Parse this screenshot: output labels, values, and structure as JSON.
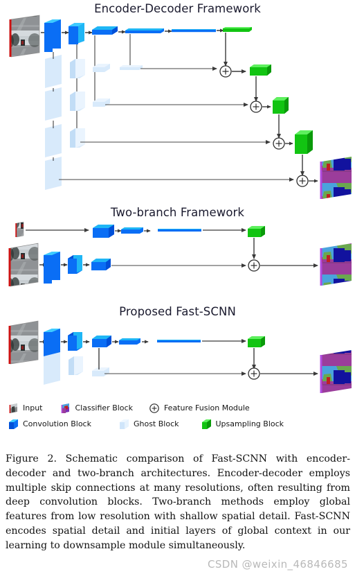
{
  "figure": {
    "panels": [
      {
        "id": "encoder-decoder",
        "title": "Encoder-Decoder Framework"
      },
      {
        "id": "two-branch",
        "title": "Two-branch Framework"
      },
      {
        "id": "fast-scnn",
        "title": "Proposed Fast-SCNN"
      }
    ]
  },
  "legend": {
    "items": [
      {
        "key": "input",
        "label": "Input",
        "glyph": "input-thumbnail-icon",
        "color": "#6f6f6f"
      },
      {
        "key": "classifier_block",
        "label": "Classifier Block",
        "glyph": "classifier-block-icon",
        "color": "#7a2fb5"
      },
      {
        "key": "feature_fusion_module",
        "label": "Feature Fusion Module",
        "glyph": "plus-circle-icon",
        "color": "#2b2b2b"
      },
      {
        "key": "convolution_block",
        "label": "Convolution Block",
        "glyph": "convolution-block-icon",
        "color": "#0a6ef5"
      },
      {
        "key": "ghost_block",
        "label": "Ghost Block",
        "glyph": "ghost-block-icon",
        "color": "#d6e8fb"
      },
      {
        "key": "upsampling_block",
        "label": "Upsampling Block",
        "glyph": "upsampling-block-icon",
        "color": "#12c412"
      }
    ]
  },
  "caption": {
    "text": "Figure 2. Schematic comparison of Fast-SCNN with encoder-decoder and two-branch architectures. Encoder-decoder employs multiple skip connections at many resolutions, often resulting from deep convolution blocks.  Two-branch methods employ global features from low resolution with shallow spatial detail. Fast-SCNN encodes spatial detail and initial layers of global context in our learning to downsample module simultaneously."
  },
  "watermark": {
    "text": "CSDN @weixin_46846685"
  },
  "colors": {
    "convolution_front": "#0a6ef5",
    "convolution_top": "#1fb6f5",
    "convolution_side": "#0050d8",
    "ghost_front": "#d8eafb",
    "ghost_top": "#eaf4fe",
    "ghost_side": "#c2ddf6",
    "upsample_front": "#12c412",
    "upsample_top": "#5ef05e",
    "upsample_side": "#0a9a0a",
    "classifier_purple": "#7a2fb5",
    "arrow": "#3a3a3a",
    "skip_line": "#6a6a6a",
    "title_text": "#1a1a2e",
    "caption_text": "#111111",
    "watermark_text": "#b9b9b9"
  },
  "chart_data": {
    "type": "diagram",
    "title": "Schematic comparison of Fast-SCNN with encoder-decoder and two-branch architectures",
    "panels": [
      {
        "name": "Encoder-Decoder Framework",
        "encoder_stages": [
          "input-image",
          "convolution-block-1",
          "convolution-block-2",
          "convolution-block-3",
          "convolution-block-4",
          "convolution-block-5",
          "upsampling-block-1"
        ],
        "ghost_rows": 4,
        "fusion_modules": 4,
        "upsampling_blocks": 4,
        "skip_connections": 4,
        "output": "segmentation-map"
      },
      {
        "name": "Two-branch Framework",
        "branches": [
          {
            "name": "global-branch",
            "stages": [
              "low-res-input",
              "convolution-block-1",
              "convolution-block-2",
              "convolution-block-3",
              "upsampling-block"
            ]
          },
          {
            "name": "spatial-branch",
            "stages": [
              "input-image",
              "convolution-block-1",
              "convolution-block-2",
              "convolution-block-3"
            ]
          }
        ],
        "fusion_modules": 1,
        "output": "segmentation-map"
      },
      {
        "name": "Proposed Fast-SCNN",
        "shared_stages": [
          "input-image",
          "convolution-block-1",
          "convolution-block-2",
          "convolution-block-3"
        ],
        "global_stages": [
          "convolution-block-4",
          "convolution-block-5",
          "upsampling-block"
        ],
        "spatial_stages": [
          "ghost-block-1",
          "ghost-block-2",
          "ghost-block-3"
        ],
        "fusion_modules": 1,
        "output": "segmentation-map"
      }
    ]
  }
}
